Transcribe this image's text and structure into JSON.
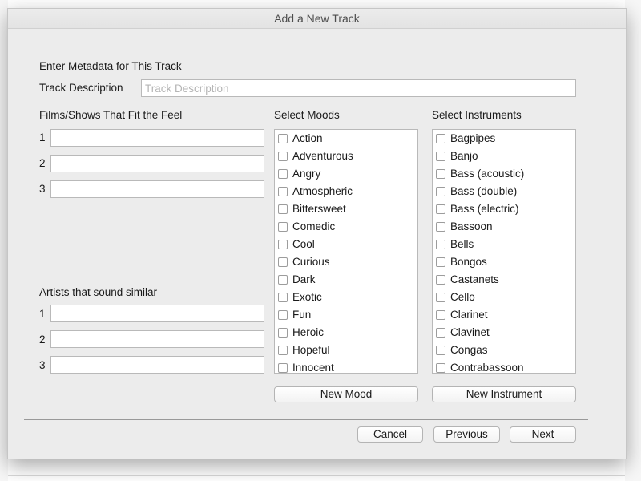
{
  "dialog": {
    "title": "Add a New Track"
  },
  "metadata": {
    "heading": "Enter Metadata for This Track",
    "description_label": "Track Description",
    "description_placeholder": "Track Description",
    "description_value": ""
  },
  "films": {
    "heading": "Films/Shows That Fit the Feel",
    "rows": [
      {
        "number": "1",
        "value": ""
      },
      {
        "number": "2",
        "value": ""
      },
      {
        "number": "3",
        "value": ""
      }
    ]
  },
  "artists": {
    "heading": "Artists that sound similar",
    "rows": [
      {
        "number": "1",
        "value": ""
      },
      {
        "number": "2",
        "value": ""
      },
      {
        "number": "3",
        "value": ""
      }
    ]
  },
  "moods": {
    "heading": "Select Moods",
    "items": [
      "Action",
      "Adventurous",
      "Angry",
      "Atmospheric",
      "Bittersweet",
      "Comedic",
      "Cool",
      "Curious",
      "Dark",
      "Exotic",
      "Fun",
      "Heroic",
      "Hopeful",
      "Innocent"
    ],
    "button_label": "New Mood"
  },
  "instruments": {
    "heading": "Select Instruments",
    "items": [
      "Bagpipes",
      "Banjo",
      "Bass (acoustic)",
      "Bass (double)",
      "Bass (electric)",
      "Bassoon",
      "Bells",
      "Bongos",
      "Castanets",
      "Cello",
      "Clarinet",
      "Clavinet",
      "Congas",
      "Contrabassoon"
    ],
    "button_label": "New Instrument"
  },
  "footer": {
    "cancel_label": "Cancel",
    "previous_label": "Previous",
    "next_label": "Next"
  }
}
